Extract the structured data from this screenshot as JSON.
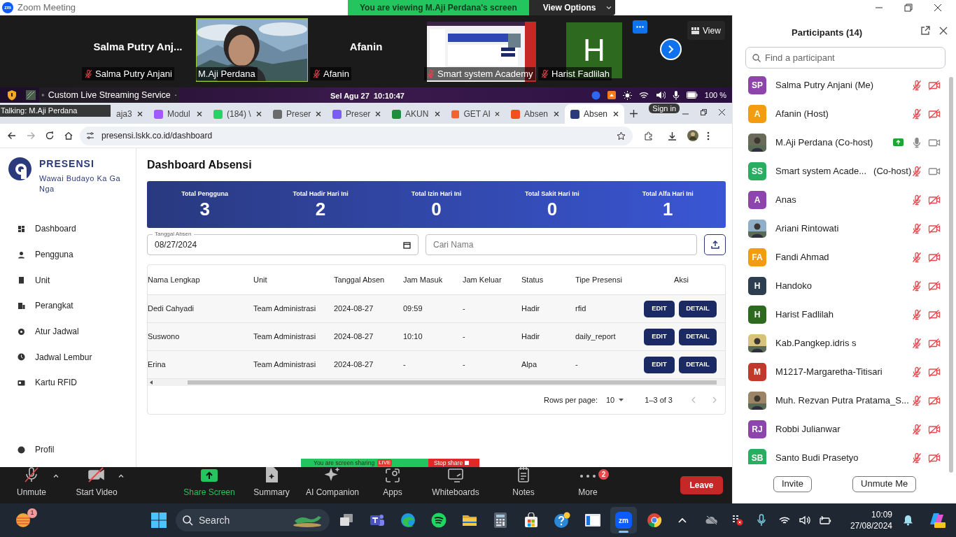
{
  "window": {
    "logo": "zm",
    "title": "Zoom Meeting"
  },
  "view_banner": {
    "text": "You are viewing M.Aji Perdana's screen",
    "button": "View Options"
  },
  "video_strip": {
    "tiles": [
      {
        "kind": "name",
        "name": "Salma Putry Anj...",
        "label": "Salma Putry Anjani",
        "muted": true
      },
      {
        "kind": "video",
        "label": "M.Aji Perdana",
        "muted": false
      },
      {
        "kind": "name",
        "name": "Afanin",
        "label": "Afanin",
        "muted": true
      },
      {
        "kind": "screen",
        "label": "Smart system Academy",
        "muted": true
      },
      {
        "kind": "avatar",
        "initial": "H",
        "color": "#2d6a1f",
        "label": "Harist Fadlilah",
        "muted": true
      }
    ],
    "view_button": "View"
  },
  "shared_screen": {
    "topbar": {
      "streaming": "Custom Live Streaming Service",
      "clock": "Sel Agu 27  10:10:47",
      "battery": "100 %"
    },
    "talking": "Talking: M.Aji Perdana",
    "sign_in": "Sign in",
    "tabs": [
      {
        "title": "aja3",
        "selected": false
      },
      {
        "title": "Modul",
        "color": "#a259ff",
        "selected": false
      },
      {
        "title": "(184) \\",
        "color": "#25d366",
        "selected": false
      },
      {
        "title": "Preser",
        "color": "#6b6b6b",
        "selected": false
      },
      {
        "title": "Preser",
        "color": "#7b5cf5",
        "selected": false
      },
      {
        "title": "AKUN",
        "color": "#1e8e3e",
        "selected": false
      },
      {
        "title": "GET AI",
        "color": "#f0652f",
        "selected": false
      },
      {
        "title": "Absen",
        "color": "#f24e1e",
        "selected": false
      },
      {
        "title": "Absen",
        "color": "#2b3a7a",
        "selected": true
      }
    ],
    "url": "presensi.lskk.co.id/dashboard",
    "app": {
      "brand": {
        "title": "PRESENSI",
        "subtitle": "Wawai Budayo Ka Ga Nga"
      },
      "nav": [
        {
          "label": "Dashboard"
        },
        {
          "label": "Pengguna"
        },
        {
          "label": "Unit"
        },
        {
          "label": "Perangkat"
        },
        {
          "label": "Atur Jadwal"
        },
        {
          "label": "Jadwal Lembur"
        },
        {
          "label": "Kartu RFID"
        }
      ],
      "profile": "Profil",
      "heading": "Dashboard Absensi",
      "stats": [
        {
          "label": "Total Pengguna",
          "value": "3"
        },
        {
          "label": "Total Hadir Hari Ini",
          "value": "2"
        },
        {
          "label": "Total Izin Hari Ini",
          "value": "0"
        },
        {
          "label": "Total Sakit Hari Ini",
          "value": "0"
        },
        {
          "label": "Total Alfa Hari Ini",
          "value": "1"
        }
      ],
      "date_field": {
        "label": "Tanggal Absen",
        "value": "08/27/2024"
      },
      "search": {
        "placeholder": "Cari Nama"
      },
      "table": {
        "columns": [
          "Nama Lengkap",
          "Unit",
          "Tanggal Absen",
          "Jam Masuk",
          "Jam Keluar",
          "Status",
          "Tipe Presensi",
          "Aksi"
        ],
        "rows": [
          {
            "cells": [
              "Dedi Cahyadi",
              "Team Administrasi",
              "2024-08-27",
              "09:59",
              "-",
              "Hadir",
              "rfid"
            ],
            "actions": [
              "EDIT",
              "DETAIL"
            ]
          },
          {
            "cells": [
              "Suswono",
              "Team Administrasi",
              "2024-08-27",
              "10:10",
              "-",
              "Hadir",
              "daily_report"
            ],
            "actions": [
              "EDIT",
              "DETAIL"
            ]
          },
          {
            "cells": [
              "Erina",
              "Team Administrasi",
              "2024-08-27",
              "-",
              "-",
              "Alpa",
              "-"
            ],
            "actions": [
              "EDIT",
              "DETAIL"
            ]
          }
        ]
      },
      "pagination": {
        "rows_label": "Rows per page:",
        "rows_value": "10",
        "range": "1–3 of 3"
      }
    },
    "sharing_bar": {
      "text": "You are screen sharing",
      "live": "LIVE",
      "stop": "Stop share"
    }
  },
  "toolbar": {
    "items": [
      {
        "kind": "mic",
        "label": "Unmute",
        "muted": true
      },
      {
        "kind": "video",
        "label": "Start Video",
        "muted": true
      },
      {
        "kind": "share",
        "label": "Share Screen"
      },
      {
        "kind": "summary",
        "label": "Summary"
      },
      {
        "kind": "ai",
        "label": "AI Companion"
      },
      {
        "kind": "apps",
        "label": "Apps"
      },
      {
        "kind": "whiteboard",
        "label": "Whiteboards"
      },
      {
        "kind": "notes",
        "label": "Notes"
      },
      {
        "kind": "more",
        "label": "More",
        "badge": "2"
      }
    ],
    "leave": "Leave"
  },
  "participants": {
    "title": "Participants (14)",
    "search": {
      "placeholder": "Find a participant"
    },
    "list": [
      {
        "name": "Salma Putry Anjani (Me)",
        "initials": "SP",
        "color": "#8e44ad",
        "muted": true,
        "video_off": true,
        "sharing": false
      },
      {
        "name": "Afanin (Host)",
        "initials": "A",
        "color": "#f39c12",
        "muted": true,
        "video_off": true,
        "sharing": false
      },
      {
        "name": "M.Aji Perdana (Co-host)",
        "photo": true,
        "muted": false,
        "video_off": false,
        "sharing": true
      },
      {
        "name": "Smart system Acade...",
        "role": "(Co-host)",
        "initials": "SS",
        "color": "#27ae60",
        "muted": true,
        "video_off": false,
        "sharing": false
      },
      {
        "name": "Anas",
        "initials": "A",
        "color": "#8e44ad",
        "muted": true,
        "video_off": true,
        "sharing": false
      },
      {
        "name": "Ariani Rintowati",
        "photo": true,
        "muted": true,
        "video_off": true,
        "sharing": false
      },
      {
        "name": "Fandi Ahmad",
        "initials": "FA",
        "color": "#f39c12",
        "muted": true,
        "video_off": true,
        "sharing": false
      },
      {
        "name": "Handoko",
        "initials": "H",
        "color": "#2c3e50",
        "muted": true,
        "video_off": true,
        "sharing": false
      },
      {
        "name": "Harist Fadlilah",
        "initials": "H",
        "color": "#2d6a1f",
        "muted": true,
        "video_off": true,
        "sharing": false
      },
      {
        "name": "Kab.Pangkep.idris s",
        "photo": true,
        "muted": true,
        "video_off": true,
        "sharing": false
      },
      {
        "name": "M1217-Margaretha-Titisari",
        "initials": "M",
        "color": "#c0392b",
        "muted": true,
        "video_off": true,
        "sharing": false
      },
      {
        "name": "Muh. Rezvan Putra Pratama_S...",
        "photo": true,
        "muted": true,
        "video_off": true,
        "sharing": false
      },
      {
        "name": "Robbi Julianwar",
        "initials": "RJ",
        "color": "#8e44ad",
        "muted": true,
        "video_off": true,
        "sharing": false
      },
      {
        "name": "Santo Budi Prasetyo",
        "initials": "SB",
        "color": "#27ae60",
        "muted": true,
        "video_off": true,
        "sharing": false
      }
    ],
    "buttons": [
      "Invite",
      "Unmute Me"
    ]
  },
  "taskbar": {
    "weather_badge": "1",
    "search": "Search",
    "zoom_logo": "zm",
    "time": "10:09",
    "date": "27/08/2024"
  }
}
